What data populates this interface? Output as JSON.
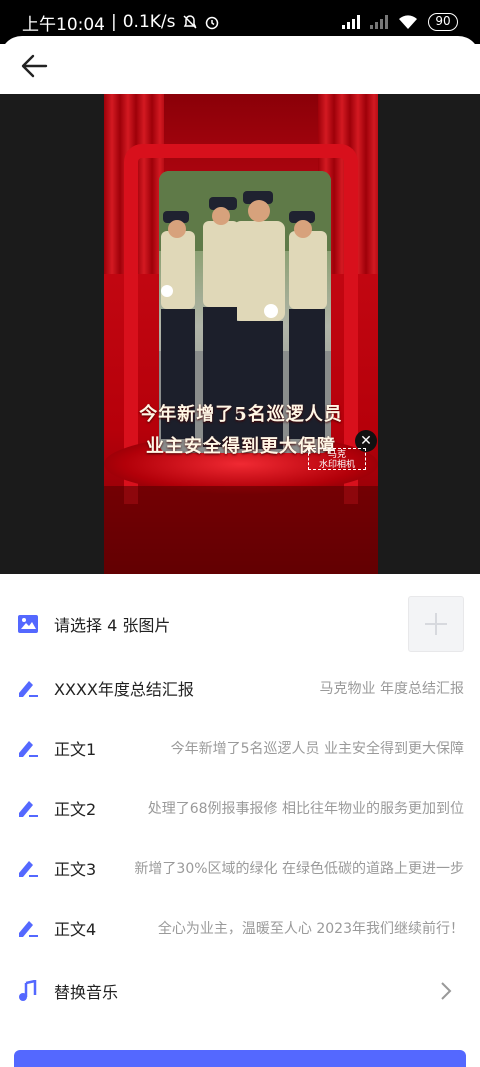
{
  "status_bar": {
    "time": "上午10:04",
    "speed": "0.1K/s",
    "battery": "90"
  },
  "colors": {
    "accent": "#5468ff",
    "stage_red": "#c40813"
  },
  "preview": {
    "caption_line1": "今年新增了5名巡逻人员",
    "caption_line2": "业主安全得到更大保障",
    "watermark_line1": "马克",
    "watermark_line2": "水印相机"
  },
  "form": {
    "images": {
      "label": "请选择 4 张图片",
      "icon": "image-icon"
    },
    "title": {
      "label": "XXXX年度总结汇报",
      "value": "马克物业 年度总结汇报",
      "icon": "edit-icon"
    },
    "body1": {
      "label": "正文1",
      "value": "今年新增了5名巡逻人员 业主安全得到更大保障",
      "icon": "edit-icon"
    },
    "body2": {
      "label": "正文2",
      "value": "处理了68例报事报修 相比往年物业的服务更加到位",
      "icon": "edit-icon"
    },
    "body3": {
      "label": "正文3",
      "value": "新增了30%区域的绿化 在绿色低碳的道路上更进一步",
      "icon": "edit-icon"
    },
    "body4": {
      "label": "正文4",
      "value": "全心为业主，温暖至人心 2023年我们继续前行！",
      "icon": "edit-icon"
    },
    "music": {
      "label": "替换音乐",
      "icon": "music-note-icon"
    }
  }
}
